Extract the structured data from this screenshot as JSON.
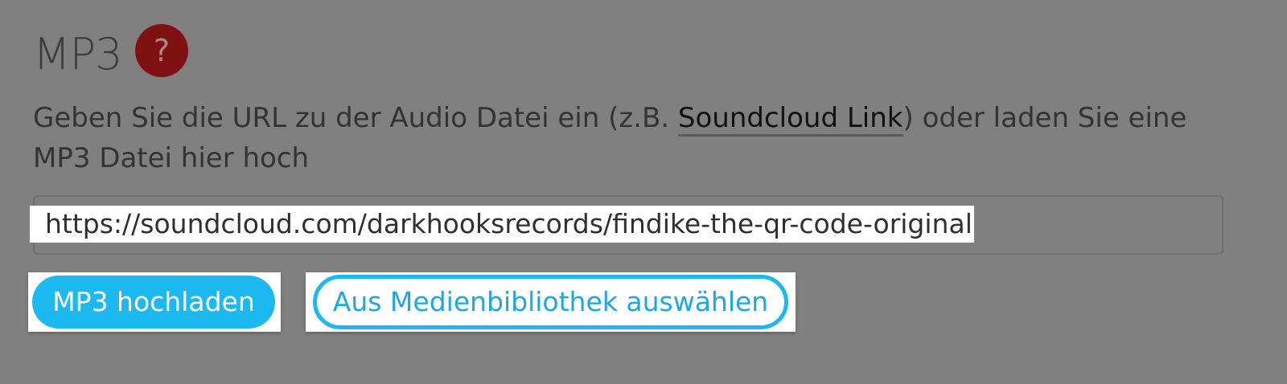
{
  "section": {
    "title": "MP3",
    "help_icon_glyph": "?",
    "description_before": "Geben Sie die URL zu der Audio Datei ein (z.B. ",
    "description_link": "Soundcloud Link",
    "description_after": ") oder laden Sie eine MP3 Datei hier hoch"
  },
  "url_field": {
    "value": "https://soundcloud.com/darkhooksrecords/findike-the-qr-code-original"
  },
  "buttons": {
    "upload_label": "MP3 hochladen",
    "library_label": "Aus Medienbibliothek auswählen"
  },
  "colors": {
    "accent": "#1cb8f0",
    "help_badge": "#7f1112",
    "overlay_background": "#808080"
  },
  "icons": {
    "help": "question-mark-icon"
  }
}
